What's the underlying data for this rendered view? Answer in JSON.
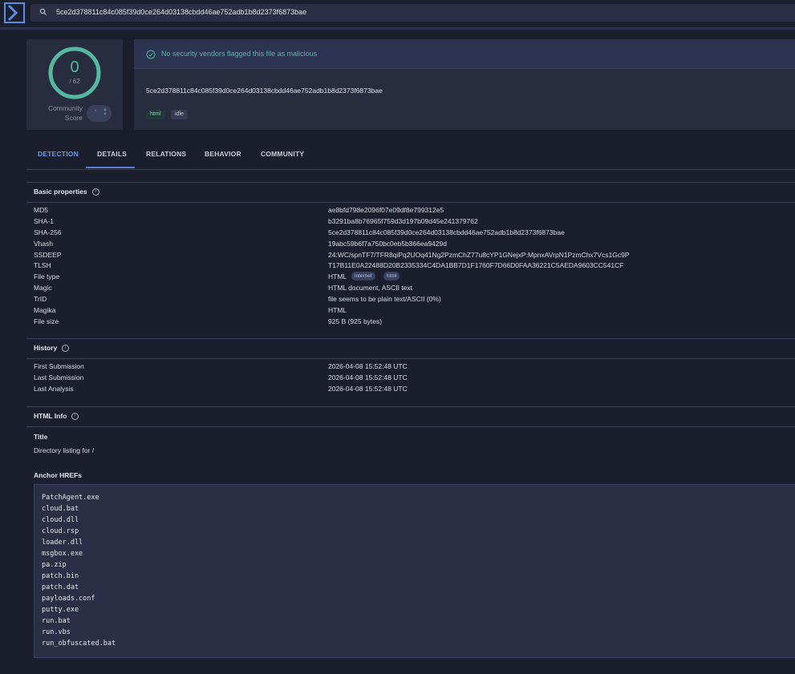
{
  "search": {
    "value": "5ce2d378811c84c085f39d0ce264d03138cbdd46ae752adb1b8d2373f6873bae"
  },
  "score": {
    "detections": "0",
    "total": "/ 62",
    "community_label_1": "Community",
    "community_label_2": "Score"
  },
  "summary": {
    "banner": "No security vendors flagged this file as malicious",
    "hash": "5ce2d378811c84c085f39d0ce264d03138cbdd46ae752adb1b8d2373f6873bae",
    "tags": [
      "html",
      "idle"
    ]
  },
  "tabs": [
    "DETECTION",
    "DETAILS",
    "RELATIONS",
    "BEHAVIOR",
    "COMMUNITY"
  ],
  "basic": {
    "title": "Basic properties",
    "rows": [
      {
        "k": "MD5",
        "v": "ae8bfd798e2096f07e09df8e799312e5"
      },
      {
        "k": "SHA-1",
        "v": "b3291ba8b76965f759d3d197b09d45e241379762"
      },
      {
        "k": "SHA-256",
        "v": "5ce2d378811c84c085f39d0ce264d03138cbdd46ae752adb1b8d2373f6873bae"
      },
      {
        "k": "Vhash",
        "v": "19abc59b6f7a750bc0eb5b366ea9429d"
      },
      {
        "k": "SSDEEP",
        "v": "24:WC/spnTF7/TFR8qiPq2UOq41Ng2PzmChZ77u8cYP1GNejxP:MpnxAVrpN1PzmChx7Vcs1Gc9P"
      },
      {
        "k": "TLSH",
        "v": "T17B11E0A22488D20B2335334C4DA1BB7D1F1760F7D66D0FAA36221C5AEDA9603CC541CF"
      },
      {
        "k": "File type",
        "v": "HTML",
        "chips": [
          "internet",
          "html"
        ]
      },
      {
        "k": "Magic",
        "v": "HTML document, ASCII text"
      },
      {
        "k": "TrID",
        "v": "file seems to be plain text/ASCII (0%)"
      },
      {
        "k": "Magika",
        "v": "HTML"
      },
      {
        "k": "File size",
        "v": "925 B (925 bytes)"
      }
    ]
  },
  "history": {
    "title": "History",
    "rows": [
      {
        "k": "First Submission",
        "v": "2026-04-08 15:52:48 UTC"
      },
      {
        "k": "Last Submission",
        "v": "2026-04-08 15:52:48 UTC"
      },
      {
        "k": "Last Analysis",
        "v": "2026-04-08 15:52:48 UTC"
      }
    ]
  },
  "html_info": {
    "title": "HTML Info",
    "title_label": "Title",
    "title_value": "Directory listing for /",
    "anchors_label": "Anchor HREFs",
    "anchors": [
      "PatchAgent.exe",
      "cloud.bat",
      "cloud.dll",
      "cloud.rsp",
      "loader.dll",
      "msgbox.exe",
      "pa.zip",
      "patch.bin",
      "patch.dat",
      "payloads.conf",
      "putty.exe",
      "run.bat",
      "run.vbs",
      "run_obfuscated.bat"
    ]
  },
  "colors": {
    "accent": "#54b8a4",
    "tab_active": "#5b7fd4",
    "background": "#1b1e2c"
  }
}
